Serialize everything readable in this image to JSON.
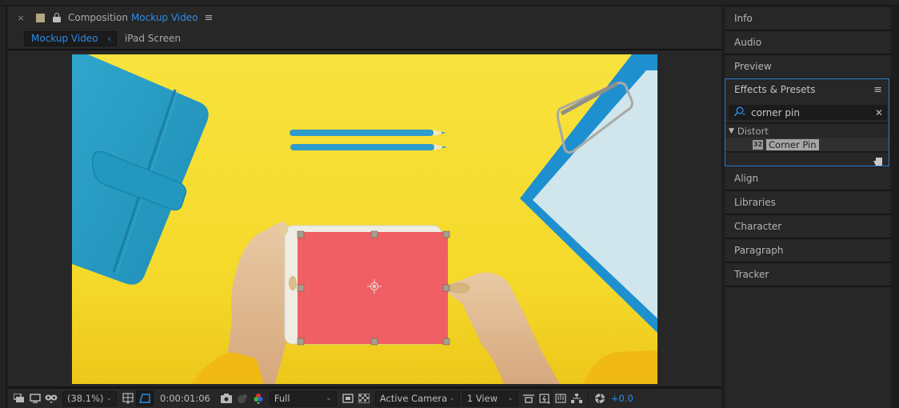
{
  "composition_panel": {
    "close_glyph": "×",
    "title_prefix": "Composition",
    "title_name": "Mockup Video",
    "menu_glyph": "≡",
    "label_color": "#b4a584",
    "breadcrumbs": [
      {
        "label": "Mockup Video",
        "active": true
      },
      {
        "label": "iPad Screen",
        "active": false
      }
    ],
    "breadcrumb_chevron": "‹"
  },
  "viewer": {
    "image_description": "Top-down photo of yellow desk with blue notebook, two blue pencils, clipboard and hands holding a white tablet",
    "layer_solid_color": "#f05f63",
    "background_color": "#f6d92c",
    "handles": [
      "top-left",
      "top-center",
      "top-right",
      "middle-left",
      "middle-right",
      "bottom-left",
      "bottom-center",
      "bottom-right"
    ]
  },
  "toolbar": {
    "icons": [
      "always-preview-icon",
      "monitor-icon",
      "mask-visibility-icon"
    ],
    "magnification": "(38.1%)",
    "grid_icon": "grid-guides-icon",
    "mask_path_icon": "mask-path-icon",
    "timecode": "0:00:01:06",
    "snapshot_icon": "camera-icon",
    "show_snapshot_icon": "show-snapshot-icon",
    "channel_icon": "rgb-channel-icon",
    "resolution": "Full",
    "region_icon": "region-of-interest-icon",
    "transparency_icon": "transparency-grid-icon",
    "camera": "Active Camera",
    "views": "1 View",
    "pixel_aspect_icon": "pixel-aspect-icon",
    "fast_preview_icon": "fast-previews-icon",
    "timeline_icon": "timeline-icon",
    "flowchart_icon": "flowchart-icon",
    "exposure_icon": "reset-exposure-icon",
    "exposure": "+0.0"
  },
  "right_panels": {
    "items_top": [
      "Info",
      "Audio",
      "Preview"
    ],
    "effects": {
      "title": "Effects & Presets",
      "menu_glyph": "≡",
      "search_value": "corner pin",
      "search_placeholder": "",
      "clear_glyph": "✕",
      "group": "Distort",
      "group_expanded": true,
      "item": "Corner Pin",
      "item_badge": "32"
    },
    "items_bottom": [
      "Align",
      "Libraries",
      "Character",
      "Paragraph",
      "Tracker"
    ]
  }
}
